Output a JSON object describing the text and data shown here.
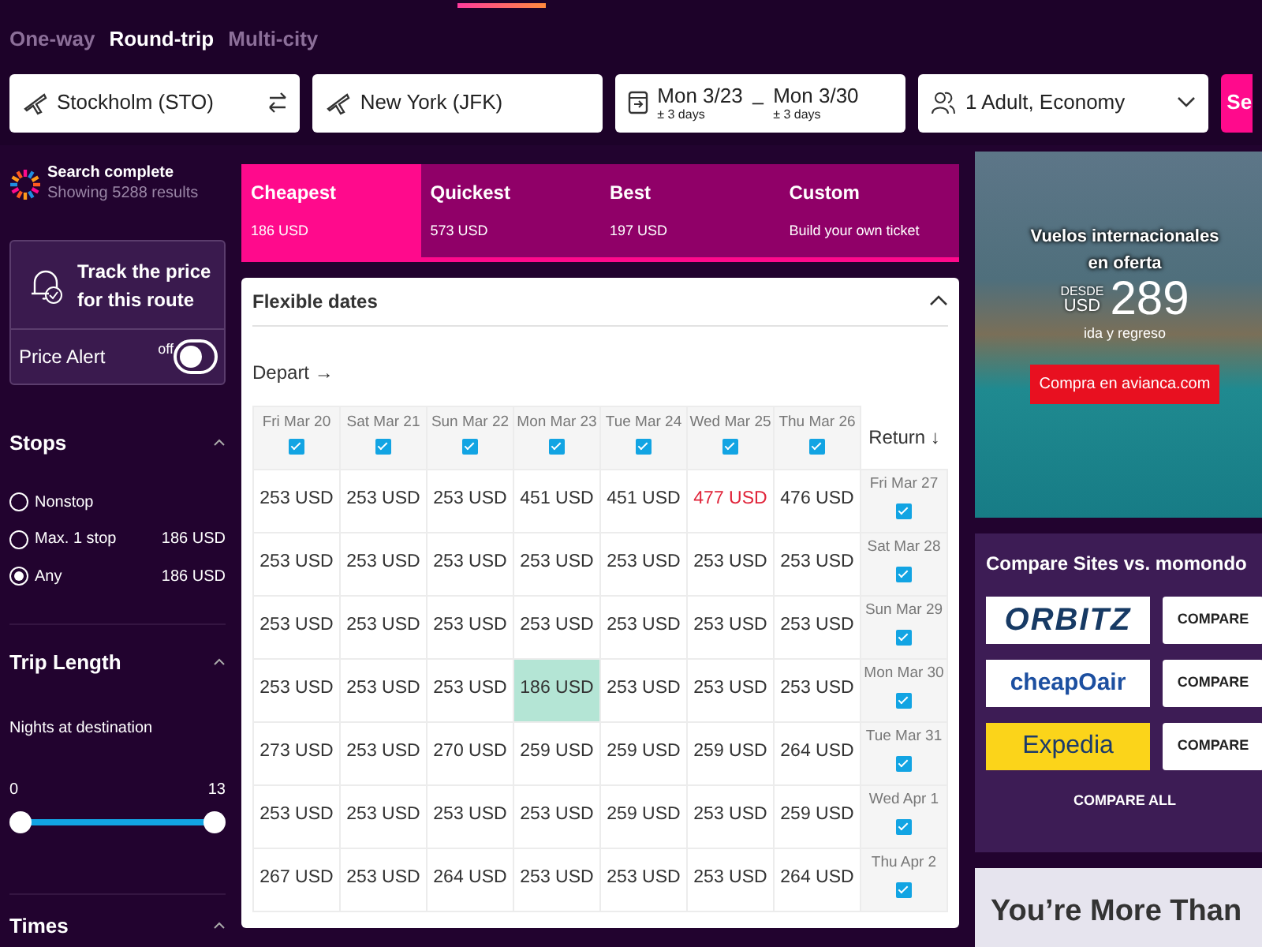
{
  "trip_types": [
    {
      "label": "One-way",
      "selected": false
    },
    {
      "label": "Round-trip",
      "selected": true
    },
    {
      "label": "Multi-city",
      "selected": false
    }
  ],
  "search": {
    "origin": "Stockholm (STO)",
    "destination": "New York (JFK)",
    "depart": "Mon 3/23",
    "depart_flex": "± 3 days",
    "dash": "–",
    "return": "Mon 3/30",
    "return_flex": "± 3 days",
    "travelers": "1 Adult, Economy",
    "search_button": "Se"
  },
  "status": {
    "title": "Search complete",
    "subtitle": "Showing 5288 results"
  },
  "price_alert": {
    "title": "Track the price for this route",
    "label": "Price Alert",
    "state_text": "off",
    "on": false
  },
  "stops": {
    "title": "Stops",
    "expanded": true,
    "options": [
      {
        "label": "Nonstop",
        "selected": false
      },
      {
        "label": "Max. 1 stop",
        "price": "186 USD",
        "selected": false
      },
      {
        "label": "Any",
        "price": "186 USD",
        "selected": true
      }
    ]
  },
  "trip_length": {
    "title": "Trip Length",
    "expanded": true,
    "caption": "Nights at destination",
    "min_label": "0",
    "max_label": "13",
    "thumbs": [
      {
        "level": 0
      },
      {
        "level": 1
      }
    ]
  },
  "times": {
    "title": "Times",
    "expanded": true
  },
  "sort_tabs": [
    {
      "label": "Cheapest",
      "sub": "186 USD",
      "selected": true
    },
    {
      "label": "Quickest",
      "sub": "573 USD",
      "selected": false
    },
    {
      "label": "Best",
      "sub": "197 USD",
      "selected": false
    },
    {
      "label": "Custom",
      "sub": "Build your own ticket",
      "selected": false
    }
  ],
  "flexible_dates": {
    "title": "Flexible dates",
    "expanded": true,
    "depart_label": "Depart →",
    "return_label": "Return ↓",
    "depart_days": [
      {
        "label": "Fri Mar 20",
        "checked": true
      },
      {
        "label": "Sat Mar 21",
        "checked": true
      },
      {
        "label": "Sun Mar 22",
        "checked": true
      },
      {
        "label": "Mon Mar 23",
        "checked": true
      },
      {
        "label": "Tue Mar 24",
        "checked": true
      },
      {
        "label": "Wed Mar 25",
        "checked": true
      },
      {
        "label": "Thu Mar 26",
        "checked": true
      }
    ],
    "rows": [
      {
        "return_day": "Fri Mar 27",
        "checked": true,
        "cells": [
          {
            "price": "253 USD",
            "kind": "plain"
          },
          {
            "price": "253 USD",
            "kind": "plain"
          },
          {
            "price": "253 USD",
            "kind": "plain"
          },
          {
            "price": "451 USD",
            "kind": "plain"
          },
          {
            "price": "451 USD",
            "kind": "plain"
          },
          {
            "price": "477 USD",
            "kind": "highest"
          },
          {
            "price": "476 USD",
            "kind": "plain"
          }
        ]
      },
      {
        "return_day": "Sat Mar 28",
        "checked": true,
        "cells": [
          {
            "price": "253 USD",
            "kind": "plain"
          },
          {
            "price": "253 USD",
            "kind": "plain"
          },
          {
            "price": "253 USD",
            "kind": "plain"
          },
          {
            "price": "253 USD",
            "kind": "plain"
          },
          {
            "price": "253 USD",
            "kind": "plain"
          },
          {
            "price": "253 USD",
            "kind": "plain"
          },
          {
            "price": "253 USD",
            "kind": "plain"
          }
        ]
      },
      {
        "return_day": "Sun Mar 29",
        "checked": true,
        "cells": [
          {
            "price": "253 USD",
            "kind": "plain"
          },
          {
            "price": "253 USD",
            "kind": "plain"
          },
          {
            "price": "253 USD",
            "kind": "plain"
          },
          {
            "price": "253 USD",
            "kind": "plain"
          },
          {
            "price": "253 USD",
            "kind": "plain"
          },
          {
            "price": "253 USD",
            "kind": "plain"
          },
          {
            "price": "253 USD",
            "kind": "plain"
          }
        ]
      },
      {
        "return_day": "Mon Mar 30",
        "checked": true,
        "cells": [
          {
            "price": "253 USD",
            "kind": "plain"
          },
          {
            "price": "253 USD",
            "kind": "plain"
          },
          {
            "price": "253 USD",
            "kind": "plain"
          },
          {
            "price": "186 USD",
            "kind": "lowest"
          },
          {
            "price": "253 USD",
            "kind": "plain"
          },
          {
            "price": "253 USD",
            "kind": "plain"
          },
          {
            "price": "253 USD",
            "kind": "plain"
          }
        ]
      },
      {
        "return_day": "Tue Mar 31",
        "checked": true,
        "cells": [
          {
            "price": "273 USD",
            "kind": "plain"
          },
          {
            "price": "253 USD",
            "kind": "plain"
          },
          {
            "price": "270 USD",
            "kind": "plain"
          },
          {
            "price": "259 USD",
            "kind": "plain"
          },
          {
            "price": "259 USD",
            "kind": "plain"
          },
          {
            "price": "259 USD",
            "kind": "plain"
          },
          {
            "price": "264 USD",
            "kind": "plain"
          }
        ]
      },
      {
        "return_day": "Wed Apr 1",
        "checked": true,
        "cells": [
          {
            "price": "253 USD",
            "kind": "plain"
          },
          {
            "price": "253 USD",
            "kind": "plain"
          },
          {
            "price": "253 USD",
            "kind": "plain"
          },
          {
            "price": "253 USD",
            "kind": "plain"
          },
          {
            "price": "259 USD",
            "kind": "plain"
          },
          {
            "price": "253 USD",
            "kind": "plain"
          },
          {
            "price": "259 USD",
            "kind": "plain"
          }
        ]
      },
      {
        "return_day": "Thu Apr 2",
        "checked": true,
        "cells": [
          {
            "price": "267 USD",
            "kind": "plain"
          },
          {
            "price": "253 USD",
            "kind": "plain"
          },
          {
            "price": "264 USD",
            "kind": "plain"
          },
          {
            "price": "253 USD",
            "kind": "plain"
          },
          {
            "price": "253 USD",
            "kind": "plain"
          },
          {
            "price": "253 USD",
            "kind": "plain"
          },
          {
            "price": "264 USD",
            "kind": "plain"
          }
        ]
      }
    ]
  },
  "ad": {
    "headline": "Vuelos internacionales en oferta",
    "from": "DESDE",
    "currency": "USD",
    "price": "289",
    "note": "ida y regreso",
    "cta": "Compra en avianca.com"
  },
  "compare": {
    "title": "Compare Sites vs. momondo",
    "sites": [
      {
        "logo": "ORBITZ",
        "kind": "orbitz",
        "button": "COMPARE"
      },
      {
        "logo": "cheapOair",
        "kind": "cheapoair",
        "button": "COMPARE"
      },
      {
        "logo": "Expedia",
        "kind": "expedia",
        "button": "COMPARE"
      }
    ],
    "all_button": "COMPARE ALL"
  },
  "promo": {
    "headline": "You’re More Than"
  }
}
